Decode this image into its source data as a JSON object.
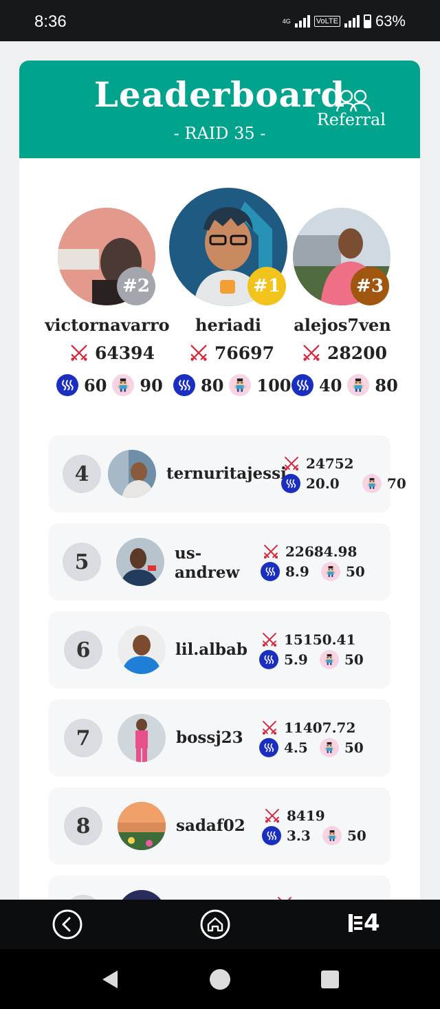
{
  "status": {
    "time": "8:36",
    "net": "4G",
    "volte": "VoLTE",
    "battery": "63%"
  },
  "header": {
    "title": "Leaderboard",
    "subtitle": "- RAID 35 -",
    "referral": "Referral"
  },
  "podium": [
    {
      "rank": "#2",
      "name": "victornavarro",
      "score": "64394",
      "steem": "60",
      "pixel": "90",
      "badge_color": "#a3a6ad"
    },
    {
      "rank": "#1",
      "name": "heriadi",
      "score": "76697",
      "steem": "80",
      "pixel": "100",
      "badge_color": "#f2c31a"
    },
    {
      "rank": "#3",
      "name": "alejos7ven",
      "score": "28200",
      "steem": "40",
      "pixel": "80",
      "badge_color": "#a0560e"
    }
  ],
  "rows": [
    {
      "rank": "4",
      "name": "ternuritajessi",
      "score": "24752",
      "steem": "20.0",
      "pixel": "70"
    },
    {
      "rank": "5",
      "name_line1": "us-",
      "name_line2": "andrew",
      "score": "22684.98",
      "steem": "8.9",
      "pixel": "50"
    },
    {
      "rank": "6",
      "name": "lil.albab",
      "score": "15150.41",
      "steem": "5.9",
      "pixel": "50"
    },
    {
      "rank": "7",
      "name": "bossj23",
      "score": "11407.72",
      "steem": "4.5",
      "pixel": "50"
    },
    {
      "rank": "8",
      "name": "sadaf02",
      "score": "8419",
      "steem": "3.3",
      "pixel": "50"
    }
  ],
  "icons": {
    "sword": "crossed-swords-icon",
    "steem": "steem-coin-icon",
    "pixel": "pixel-avatar-icon"
  },
  "nav": {
    "back": "back-icon",
    "home": "home-icon",
    "logo": "H4"
  }
}
